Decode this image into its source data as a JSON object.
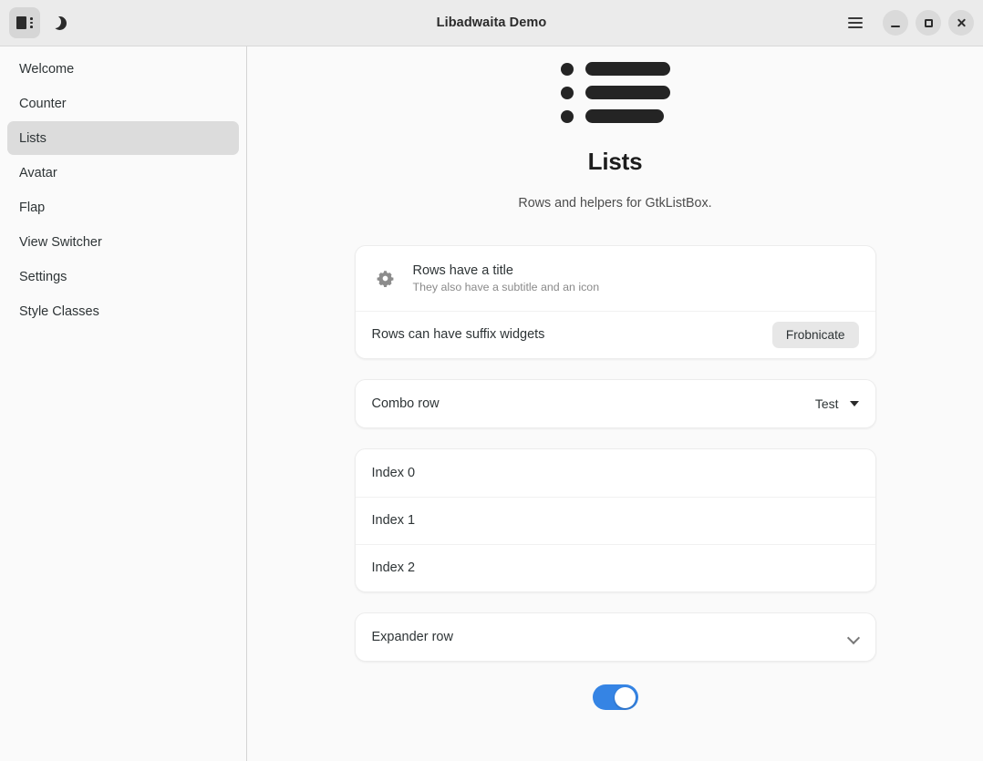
{
  "window": {
    "title": "Libadwaita Demo",
    "sidebar_toggle_icon": "sidebar-show-icon",
    "dark_mode_icon": "moon-icon",
    "menu_icon": "hamburger-menu-icon",
    "minimize_icon": "minimize-icon",
    "maximize_icon": "maximize-icon",
    "close_icon": "close-icon"
  },
  "sidebar": {
    "items": [
      {
        "label": "Welcome",
        "selected": false
      },
      {
        "label": "Counter",
        "selected": false
      },
      {
        "label": "Lists",
        "selected": true
      },
      {
        "label": "Avatar",
        "selected": false
      },
      {
        "label": "Flap",
        "selected": false
      },
      {
        "label": "View Switcher",
        "selected": false
      },
      {
        "label": "Settings",
        "selected": false
      },
      {
        "label": "Style Classes",
        "selected": false
      }
    ]
  },
  "page": {
    "icon": "list-bullets-icon",
    "title": "Lists",
    "subtitle": "Rows and helpers for GtkListBox."
  },
  "cards": {
    "basic": {
      "title_row": {
        "icon": "gear-icon",
        "title": "Rows have a title",
        "subtitle": "They also have a subtitle and an icon"
      },
      "suffix_row": {
        "title": "Rows can have suffix widgets",
        "button_label": "Frobnicate"
      }
    },
    "combo": {
      "title": "Combo row",
      "value": "Test",
      "icon": "triangle-down-icon"
    },
    "indexes": {
      "rows": [
        {
          "label": "Index 0"
        },
        {
          "label": "Index 1"
        },
        {
          "label": "Index 2"
        }
      ]
    },
    "expander": {
      "title": "Expander row",
      "icon": "chevron-down-icon"
    }
  },
  "toggle": {
    "name": "expander-enable-switch",
    "state": "on",
    "accent_color": "#3584e4"
  },
  "colors": {
    "headerbar_bg": "#ebebeb",
    "window_bg": "#fafafa",
    "card_bg": "#ffffff",
    "sidebar_selected_bg": "#dcdcdc",
    "accent": "#3584e4",
    "text": "#2e3436",
    "dim_text": "#8a8a8a"
  }
}
